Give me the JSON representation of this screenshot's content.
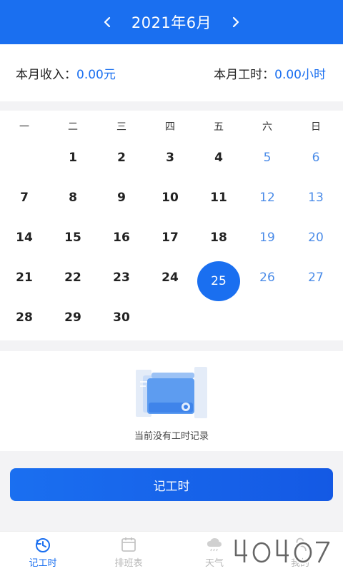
{
  "header": {
    "title": "2021年6月",
    "prev_icon": "chevron-left-icon",
    "next_icon": "chevron-right-icon"
  },
  "stats": {
    "income_label": "本月收入：",
    "income_value": "0.00元",
    "hours_label": "本月工时：",
    "hours_value": "0.00小时"
  },
  "calendar": {
    "weekdays": [
      "一",
      "二",
      "三",
      "四",
      "五",
      "六",
      "日"
    ],
    "first_weekday_index": 1,
    "days": [
      "1",
      "2",
      "3",
      "4",
      "5",
      "6",
      "7",
      "8",
      "9",
      "10",
      "11",
      "12",
      "13",
      "14",
      "15",
      "16",
      "17",
      "18",
      "19",
      "20",
      "21",
      "22",
      "23",
      "24",
      "25",
      "26",
      "27",
      "28",
      "29",
      "30"
    ],
    "selected_day": "25"
  },
  "empty_state": {
    "icon": "document-empty-icon",
    "message": "当前没有工时记录"
  },
  "record_button": {
    "label": "记工时"
  },
  "tabbar": {
    "tabs": [
      {
        "label": "记工时",
        "icon": "clock-refresh-icon",
        "active": true
      },
      {
        "label": "排班表",
        "icon": "calendar-icon",
        "active": false
      },
      {
        "label": "天气",
        "icon": "cloud-rain-icon",
        "active": false
      },
      {
        "label": "我的",
        "icon": "user-icon",
        "active": false
      }
    ]
  },
  "colors": {
    "primary": "#1a6ff0",
    "weekend": "#4a8be8",
    "inactive_tab": "#b8b8b8"
  }
}
